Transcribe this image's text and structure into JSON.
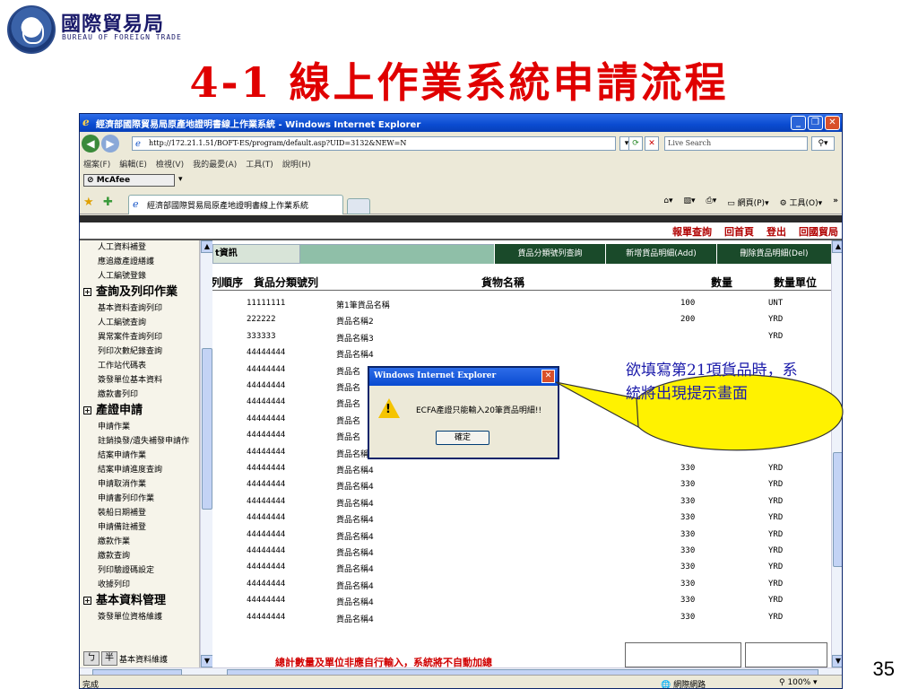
{
  "slide": {
    "logo_title": "國際貿易局",
    "logo_sub": "BUREAU OF FOREIGN TRADE",
    "title": "4-1 線上作業系統申請流程",
    "page_number": "35",
    "callout": "欲填寫第21項貨品時，系統將出現提示畫面",
    "callout_color": "#fff200"
  },
  "browser": {
    "window_title": "經濟部國際貿易局原產地證明書線上作業系統 - Windows Internet Explorer",
    "address": "http://172.21.1.51/BOFT-ES/program/default.asp?UID=3132&NEW=N",
    "search_placeholder": "Live Search",
    "menu": [
      "檔案(F)",
      "編輯(E)",
      "檢視(V)",
      "我的最愛(A)",
      "工具(T)",
      "說明(H)"
    ],
    "mcafee": "McAfee",
    "tab_title": "經濟部國際貿易局原產地證明書線上作業系統",
    "cmd_page": "網頁(P)",
    "cmd_tools": "工具(O)",
    "status_text": "完成",
    "status_zone": "網際網路",
    "status_zoom": "100%"
  },
  "webpage": {
    "top_links": [
      "報單查詢",
      "回首頁",
      "登出",
      "回國貿局"
    ],
    "sidebar_items": [
      {
        "type": "item",
        "label": "人工資料補登"
      },
      {
        "type": "item",
        "label": "應追繳產證繕護"
      },
      {
        "type": "item",
        "label": "人工編號登錄"
      },
      {
        "type": "section",
        "label": "查詢及列印作業"
      },
      {
        "type": "item",
        "label": "基本資料查詢列印"
      },
      {
        "type": "item",
        "label": "人工編號查詢"
      },
      {
        "type": "item",
        "label": "異常案件查詢列印"
      },
      {
        "type": "item",
        "label": "列印次數紀錄查詢"
      },
      {
        "type": "item",
        "label": "工作站代碼表"
      },
      {
        "type": "item",
        "label": "簽發單位基本資料"
      },
      {
        "type": "item",
        "label": "繳款書列印"
      },
      {
        "type": "section",
        "label": "產證申請"
      },
      {
        "type": "item",
        "label": "申請作業"
      },
      {
        "type": "item",
        "label": "註銷換發/遺失補發申請作"
      },
      {
        "type": "item",
        "label": "結案申請作業"
      },
      {
        "type": "item",
        "label": "結案申請進度查詢"
      },
      {
        "type": "item",
        "label": "申請取消作業"
      },
      {
        "type": "item",
        "label": "申請書列印作業"
      },
      {
        "type": "item",
        "label": "裝船日期補登"
      },
      {
        "type": "item",
        "label": "申請備註補登"
      },
      {
        "type": "item",
        "label": "繳款作業"
      },
      {
        "type": "item",
        "label": "繳款查詢"
      },
      {
        "type": "item",
        "label": "列印驗證碼設定"
      },
      {
        "type": "item",
        "label": "收據列印"
      },
      {
        "type": "section",
        "label": "基本資料管理"
      },
      {
        "type": "item",
        "label": "簽發單位資格維護"
      }
    ],
    "sidebar_bottom": {
      "key1": "ㄅ",
      "key2": "半",
      "label": "基本資料維護"
    },
    "info_label": "t資訊",
    "header_buttons": [
      "貨品分類號列查詢",
      "新增貨品明細(Add)",
      "刪除貨品明細(Del)"
    ],
    "columns": [
      "列順序",
      "貨品分類號列",
      "貨物名稱",
      "數量",
      "數量單位"
    ],
    "rows": [
      {
        "code": "11111111",
        "name": "第1筆貨品名稱",
        "qty": "100",
        "unit": "UNT"
      },
      {
        "code": "222222",
        "name": "貨品名稱2",
        "qty": "200",
        "unit": "YRD"
      },
      {
        "code": "333333",
        "name": "貨品名稱3",
        "qty": "",
        "unit": "YRD"
      },
      {
        "code": "44444444",
        "name": "貨品名稱4",
        "qty": "",
        "unit": ""
      },
      {
        "code": "44444444",
        "name": "貨品名",
        "qty": "",
        "unit": ""
      },
      {
        "code": "44444444",
        "name": "貨品名",
        "qty": "",
        "unit": ""
      },
      {
        "code": "44444444",
        "name": "貨品名",
        "qty": "",
        "unit": ""
      },
      {
        "code": "44444444",
        "name": "貨品名",
        "qty": "",
        "unit": ""
      },
      {
        "code": "44444444",
        "name": "貨品名",
        "qty": "",
        "unit": ""
      },
      {
        "code": "44444444",
        "name": "貨品名稱4",
        "qty": "",
        "unit": ""
      },
      {
        "code": "44444444",
        "name": "貨品名稱4",
        "qty": "330",
        "unit": "YRD"
      },
      {
        "code": "44444444",
        "name": "貨品名稱4",
        "qty": "330",
        "unit": "YRD"
      },
      {
        "code": "44444444",
        "name": "貨品名稱4",
        "qty": "330",
        "unit": "YRD"
      },
      {
        "code": "44444444",
        "name": "貨品名稱4",
        "qty": "330",
        "unit": "YRD"
      },
      {
        "code": "44444444",
        "name": "貨品名稱4",
        "qty": "330",
        "unit": "YRD"
      },
      {
        "code": "44444444",
        "name": "貨品名稱4",
        "qty": "330",
        "unit": "YRD"
      },
      {
        "code": "44444444",
        "name": "貨品名稱4",
        "qty": "330",
        "unit": "YRD"
      },
      {
        "code": "44444444",
        "name": "貨品名稱4",
        "qty": "330",
        "unit": "YRD"
      },
      {
        "code": "44444444",
        "name": "貨品名稱4",
        "qty": "330",
        "unit": "YRD"
      },
      {
        "code": "44444444",
        "name": "貨品名稱4",
        "qty": "330",
        "unit": "YRD"
      }
    ],
    "footer_note": "總計數量及單位非應自行輸入，系統將不自動加總"
  },
  "dialog": {
    "title": "Windows Internet Explorer",
    "message": "ECFA產證只能輸入20筆貨品明細!!",
    "ok_label": "確定"
  }
}
